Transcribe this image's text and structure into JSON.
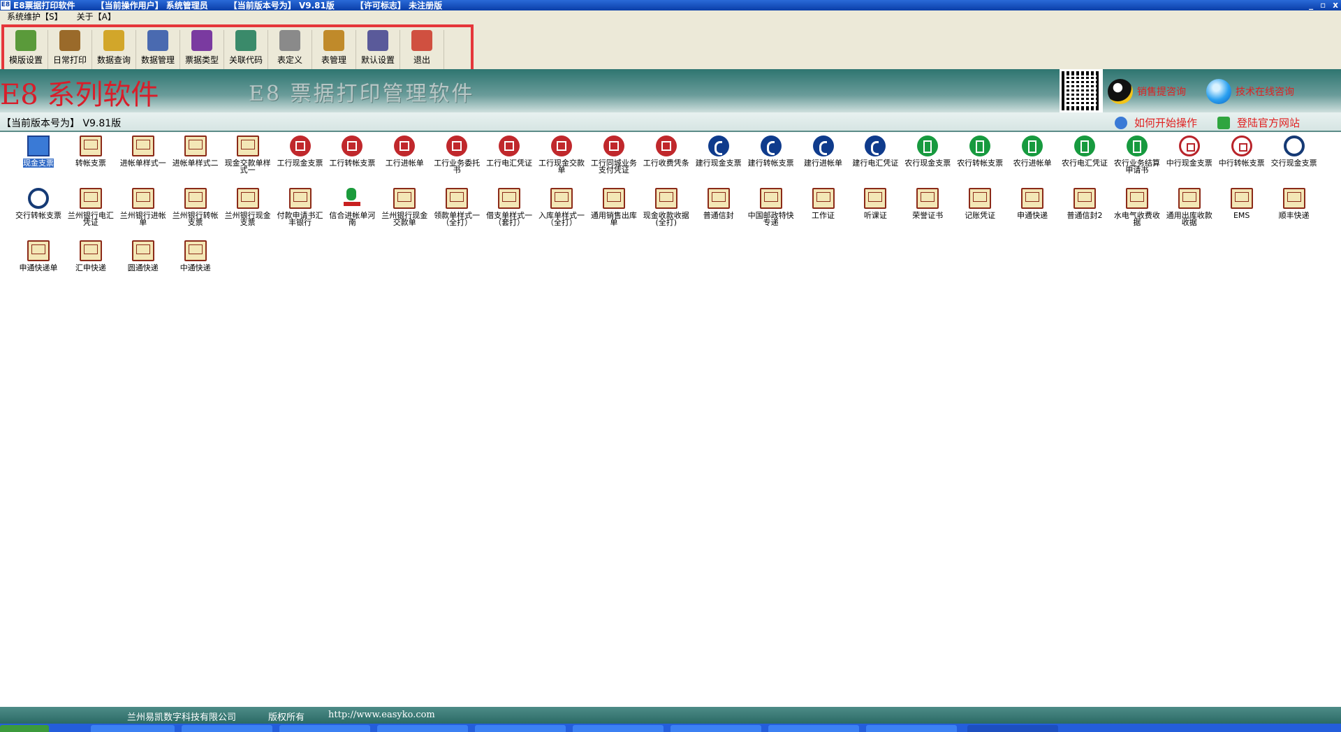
{
  "window": {
    "app_icon_text": "E8",
    "title": "E8票据打印软件",
    "current_user_label": "【当前操作用户】",
    "current_user": "系统管理员",
    "version_label": "【当前版本号为】",
    "version": "V9.81版",
    "license_label": "【许可标志】",
    "license": "未注册版",
    "minimize": "_",
    "restore": "▫",
    "close": "x"
  },
  "menu": {
    "items": [
      "系统维护【S】",
      "关于【A】"
    ]
  },
  "toolbar": {
    "items": [
      "模版设置",
      "日常打印",
      "数据查询",
      "数据管理",
      "票据类型",
      "关联代码",
      "表定义",
      "表管理",
      "默认设置",
      "退出"
    ]
  },
  "banner": {
    "brand": "E8 系列软件",
    "subtitle": "E8 票据打印管理软件",
    "contact1": "销售提咨询",
    "contact2": "技术在线咨询"
  },
  "version_bar": {
    "text": "【当前版本号为】 V9.81版",
    "help": "如何开始操作",
    "site": "登陆官方网站"
  },
  "templates": [
    {
      "label": "现金支票",
      "icon": "cash"
    },
    {
      "label": "转帐支票",
      "icon": "book"
    },
    {
      "label": "进帐单样式一",
      "icon": "book"
    },
    {
      "label": "进帐单样式二",
      "icon": "book"
    },
    {
      "label": "现金交款单样式一",
      "icon": "book"
    },
    {
      "label": "工行现金支票",
      "icon": "icbc"
    },
    {
      "label": "工行转帐支票",
      "icon": "icbc"
    },
    {
      "label": "工行进帐单",
      "icon": "icbc"
    },
    {
      "label": "工行业务委托书",
      "icon": "icbc"
    },
    {
      "label": "工行电汇凭证",
      "icon": "icbc"
    },
    {
      "label": "工行现金交款单",
      "icon": "icbc"
    },
    {
      "label": "工行同城业务支付凭证",
      "icon": "icbc"
    },
    {
      "label": "工行收费凭条",
      "icon": "icbc"
    },
    {
      "label": "建行现金支票",
      "icon": "ccb"
    },
    {
      "label": "建行转帐支票",
      "icon": "ccb"
    },
    {
      "label": "建行进帐单",
      "icon": "ccb"
    },
    {
      "label": "建行电汇凭证",
      "icon": "ccb"
    },
    {
      "label": "农行现金支票",
      "icon": "abc"
    },
    {
      "label": "农行转帐支票",
      "icon": "abc"
    },
    {
      "label": "农行进帐单",
      "icon": "abc"
    },
    {
      "label": "农行电汇凭证",
      "icon": "abc"
    },
    {
      "label": "农行业务结算申请书",
      "icon": "abc"
    },
    {
      "label": "中行现金支票",
      "icon": "boc"
    },
    {
      "label": "中行转帐支票",
      "icon": "boc"
    },
    {
      "label": "交行现金支票",
      "icon": "bocom"
    },
    {
      "label": "交行转帐支票",
      "icon": "bocom"
    },
    {
      "label": "兰州银行电汇凭证",
      "icon": "book"
    },
    {
      "label": "兰州银行进帐单",
      "icon": "book"
    },
    {
      "label": "兰州银行转帐支票",
      "icon": "book"
    },
    {
      "label": "兰州银行现金支票",
      "icon": "book"
    },
    {
      "label": "付款申请书汇丰银行",
      "icon": "book"
    },
    {
      "label": "信合进帐单河南",
      "icon": "post"
    },
    {
      "label": "兰州银行现金交款单",
      "icon": "book"
    },
    {
      "label": "领款单样式一（全打）",
      "icon": "book"
    },
    {
      "label": "借支单样式一（套打）",
      "icon": "book"
    },
    {
      "label": "入库单样式一（全打）",
      "icon": "book"
    },
    {
      "label": "通用销售出库单",
      "icon": "book"
    },
    {
      "label": "现金收款收据(全打)",
      "icon": "book"
    },
    {
      "label": "普通信封",
      "icon": "book"
    },
    {
      "label": "中国邮政特快专递",
      "icon": "book"
    },
    {
      "label": "工作证",
      "icon": "book"
    },
    {
      "label": "听课证",
      "icon": "book"
    },
    {
      "label": "荣誉证书",
      "icon": "book"
    },
    {
      "label": "记账凭证",
      "icon": "book"
    },
    {
      "label": "申通快递",
      "icon": "book"
    },
    {
      "label": "普通信封2",
      "icon": "book"
    },
    {
      "label": "水电气收费收据",
      "icon": "book"
    },
    {
      "label": "通用出库收款收据",
      "icon": "book"
    },
    {
      "label": "EMS",
      "icon": "book"
    },
    {
      "label": "顺丰快递",
      "icon": "book"
    },
    {
      "label": "申通快递单",
      "icon": "book"
    },
    {
      "label": "汇申快递",
      "icon": "book"
    },
    {
      "label": "圆通快递",
      "icon": "book"
    },
    {
      "label": "中通快递",
      "icon": "book"
    }
  ],
  "footer": {
    "company": "兰州易凯数字科技有限公司",
    "rights": "版权所有",
    "url": "http://www.easyko.com"
  },
  "colors": {
    "title_bar": "#0a3ea8",
    "banner_teal": "#2e7570",
    "highlight_red": "#e5363a",
    "brand_red": "#d81e2a"
  }
}
